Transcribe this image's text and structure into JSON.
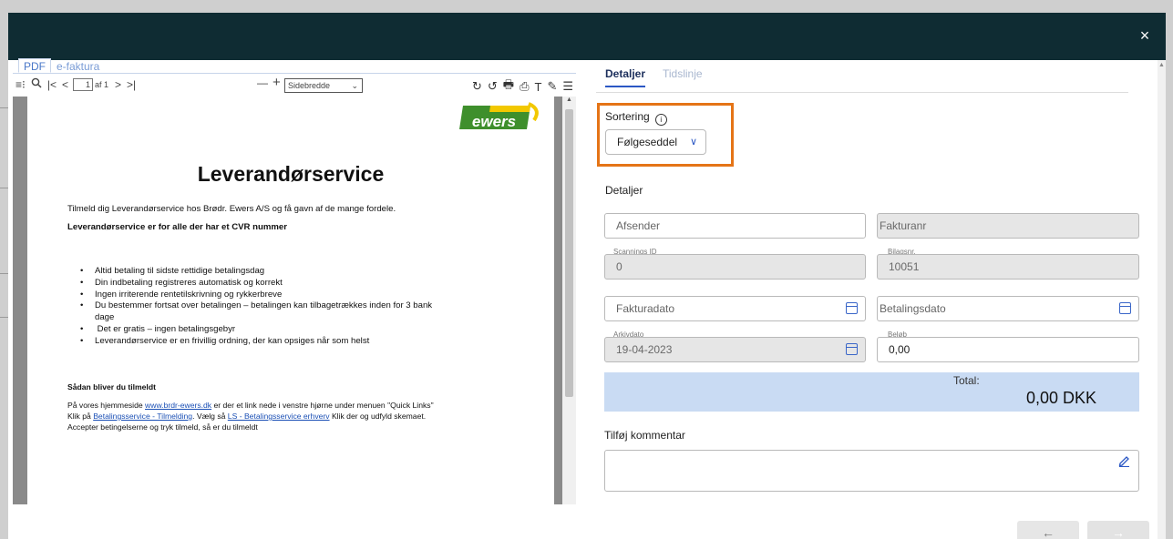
{
  "modal": {
    "close_label": "×"
  },
  "viewer": {
    "tabs": [
      "PDF",
      "e-faktura"
    ],
    "toolbar": {
      "sidebar_icon": "≡⁝",
      "search_icon": "🔍",
      "first_icon": "|<",
      "prev_icon": "<",
      "page": "1",
      "page_of": "af 1",
      "next_icon": ">",
      "last_icon": ">|",
      "zoom_out": "—",
      "zoom_in": "+",
      "zoom_value": "Sidebredde",
      "right_icons": [
        "↻",
        "↺",
        "🖶",
        "⎙",
        "T",
        "✎",
        "☰"
      ]
    },
    "pdf": {
      "logo_text": "ewers",
      "title": "Leverandørservice",
      "intro": "Tilmeld dig Leverandørservice hos Brødr. Ewers A/S og få gavn af de mange fordele.",
      "subtitle": "Leverandørservice er for alle der har et CVR nummer",
      "bullets": [
        "Altid betaling til sidste rettidige betalingsdag",
        "Din indbetaling registreres automatisk og korrekt",
        "Ingen irriterende rentetilskrivning og rykkerbreve",
        "Du bestemmer fortsat over betalingen – betalingen kan tilbagetrækkes inden for 3 bank",
        "dage",
        " Det er gratis – ingen betalingsgebyr",
        "Leverandørservice er en frivillig ordning, der kan opsiges når som helst"
      ],
      "howto_title": "Sådan bliver du tilmeldt",
      "line1_a": "På vores hjemmeside ",
      "line1_link": "www.brdr-ewers.dk",
      "line1_b": " er der et link nede i venstre hjørne under menuen \"Quick Links\"",
      "line2_a": "Klik på ",
      "line2_link1": "Betalingsservice - Tilmelding",
      "line2_b": ". Vælg så ",
      "line2_link2": "LS - Betalingsservice erhverv",
      "line2_c": " Klik der og udfyld skemaet.",
      "line3": "Accepter betingelserne og tryk tilmeld, så er du tilmeldt"
    }
  },
  "details": {
    "tabs": {
      "active": "Detaljer",
      "inactive": "Tidslinje"
    },
    "sort_label": "Sortering",
    "info_icon": "i",
    "sort_value": "Følgeseddel",
    "sort_chevron": "∨",
    "section_title": "Detaljer",
    "fields": {
      "afsender_placeholder": "Afsender",
      "fakturanr_placeholder": "Fakturanr",
      "scanningsid_label": "Scannings ID",
      "scanningsid_value": "0",
      "bilagsnr_label": "Bilagsnr.",
      "bilagsnr_value": "10051",
      "fakturadato_placeholder": "Fakturadato",
      "betalingsdato_placeholder": "Betalingsdato",
      "arkivdato_label": "Arkivdato",
      "arkivdato_value": "19-04-2023",
      "beloeb_label": "Beløb",
      "beloeb_value": "0,00"
    },
    "total_label": "Total:",
    "total_value": "0,00 DKK",
    "comment_label": "Tilføj kommentar",
    "nav": {
      "prev": "←",
      "next": "→"
    }
  },
  "colors": {
    "header": "#0f2c33",
    "accent": "#2b57c4",
    "highlight": "#e57416",
    "total_bg": "#c9dbf3"
  }
}
